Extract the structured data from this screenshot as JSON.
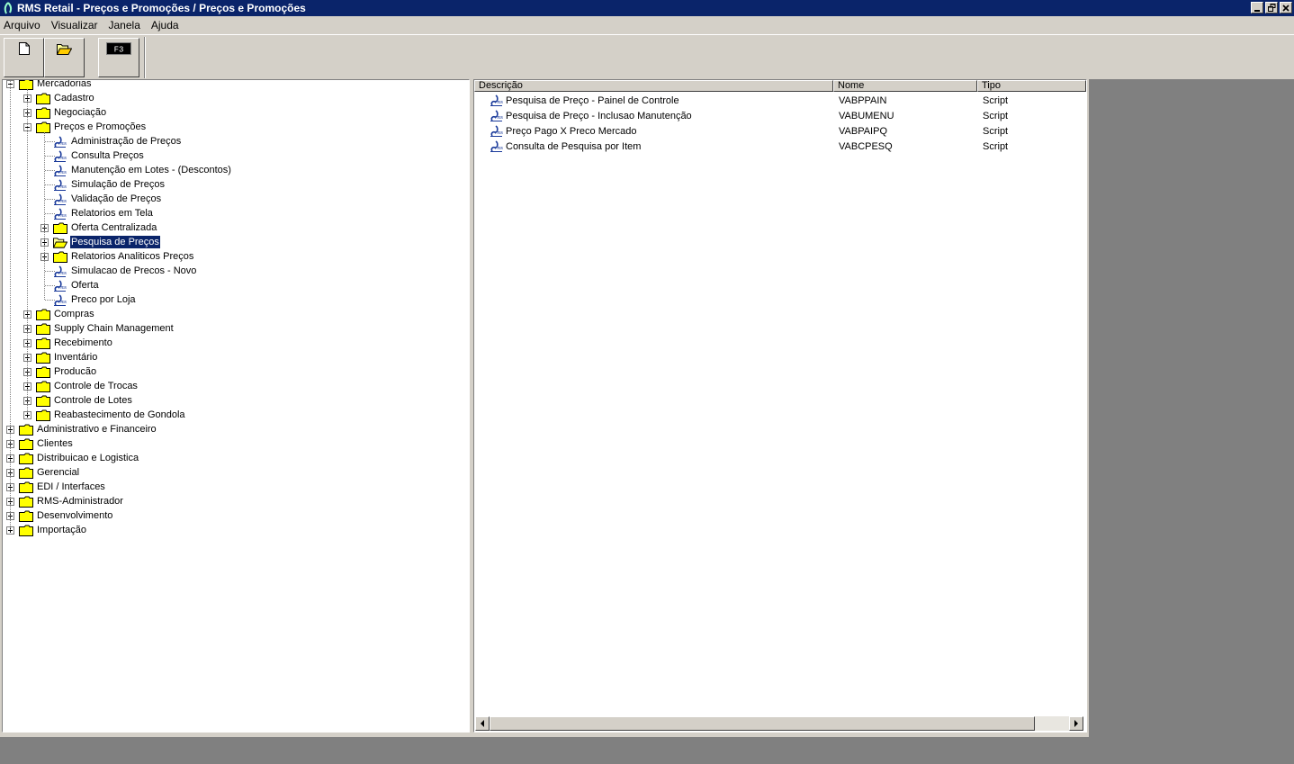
{
  "window": {
    "title": "RMS Retail - Preços e Promoções / Preços e Promoções",
    "controls": [
      "minimize-icon",
      "restore-icon",
      "close-icon"
    ]
  },
  "menu": {
    "items": [
      {
        "label": "Arquivo"
      },
      {
        "label": "Visualizar"
      },
      {
        "label": "Janela"
      },
      {
        "label": "Ajuda"
      }
    ]
  },
  "toolbar": {
    "buttons": [
      {
        "icon": "new-document-icon"
      },
      {
        "icon": "open-folder-icon"
      },
      {
        "icon": "f3-key-icon",
        "label": "F3"
      }
    ]
  },
  "tree": {
    "items": [
      {
        "label": "Mercadorias",
        "level": 0,
        "type": "folder",
        "state": "expanded"
      },
      {
        "label": "Cadastro",
        "level": 1,
        "type": "folder",
        "state": "collapsed"
      },
      {
        "label": "Negociação",
        "level": 1,
        "type": "folder",
        "state": "collapsed"
      },
      {
        "label": "Preços e Promoções",
        "level": 1,
        "type": "folder",
        "state": "expanded"
      },
      {
        "label": "Administração de Preços",
        "level": 2,
        "type": "script"
      },
      {
        "label": "Consulta Preços",
        "level": 2,
        "type": "script"
      },
      {
        "label": "Manutenção em Lotes - (Descontos)",
        "level": 2,
        "type": "script"
      },
      {
        "label": "Simulação de Preços",
        "level": 2,
        "type": "script"
      },
      {
        "label": "Validação de Preços",
        "level": 2,
        "type": "script"
      },
      {
        "label": "Relatorios em Tela",
        "level": 2,
        "type": "script"
      },
      {
        "label": "Oferta Centralizada",
        "level": 2,
        "type": "folder",
        "state": "collapsed"
      },
      {
        "label": "Pesquisa de Preços",
        "level": 2,
        "type": "folder",
        "state": "collapsed",
        "selected": true
      },
      {
        "label": "Relatorios Analiticos Preços",
        "level": 2,
        "type": "folder",
        "state": "collapsed"
      },
      {
        "label": "Simulacao de Precos - Novo",
        "level": 2,
        "type": "script"
      },
      {
        "label": "Oferta",
        "level": 2,
        "type": "script"
      },
      {
        "label": "Preco por Loja",
        "level": 2,
        "type": "script"
      },
      {
        "label": "Compras",
        "level": 1,
        "type": "folder",
        "state": "collapsed"
      },
      {
        "label": "Supply Chain Management",
        "level": 1,
        "type": "folder",
        "state": "collapsed"
      },
      {
        "label": "Recebimento",
        "level": 1,
        "type": "folder",
        "state": "collapsed"
      },
      {
        "label": "Inventário",
        "level": 1,
        "type": "folder",
        "state": "collapsed"
      },
      {
        "label": "Producão",
        "level": 1,
        "type": "folder",
        "state": "collapsed"
      },
      {
        "label": "Controle de Trocas",
        "level": 1,
        "type": "folder",
        "state": "collapsed"
      },
      {
        "label": "Controle de Lotes",
        "level": 1,
        "type": "folder",
        "state": "collapsed"
      },
      {
        "label": "Reabastecimento de Gondola",
        "level": 1,
        "type": "folder",
        "state": "collapsed"
      },
      {
        "label": "Administrativo e Financeiro",
        "level": 0,
        "type": "folder",
        "state": "collapsed"
      },
      {
        "label": "Clientes",
        "level": 0,
        "type": "folder",
        "state": "collapsed"
      },
      {
        "label": "Distribuicao e Logistica",
        "level": 0,
        "type": "folder",
        "state": "collapsed"
      },
      {
        "label": "Gerencial",
        "level": 0,
        "type": "folder",
        "state": "collapsed"
      },
      {
        "label": "EDI / Interfaces",
        "level": 0,
        "type": "folder",
        "state": "collapsed"
      },
      {
        "label": "RMS-Administrador",
        "level": 0,
        "type": "folder",
        "state": "collapsed"
      },
      {
        "label": "Desenvolvimento",
        "level": 0,
        "type": "folder",
        "state": "collapsed"
      },
      {
        "label": "Importação",
        "level": 0,
        "type": "folder",
        "state": "collapsed"
      }
    ]
  },
  "list": {
    "columns": [
      "Descrição",
      "Nome",
      "Tipo"
    ],
    "rows": [
      {
        "descricao": "Pesquisa de Preço - Painel de Controle",
        "nome": "VABPPAIN",
        "tipo": "Script"
      },
      {
        "descricao": "Pesquisa de Preço - Inclusao Manutenção",
        "nome": "VABUMENU",
        "tipo": "Script"
      },
      {
        "descricao": "Preço Pago X Preco Mercado",
        "nome": "VABPAIPQ",
        "tipo": "Script"
      },
      {
        "descricao": "Consulta de Pesquisa por Item",
        "nome": "VABCPESQ",
        "tipo": "Script"
      }
    ]
  },
  "colors": {
    "titlebar": "#0a246a",
    "face": "#d4d0c8",
    "desktop": "#808080",
    "folder": "#ffff00",
    "selection": "#0a246a"
  }
}
